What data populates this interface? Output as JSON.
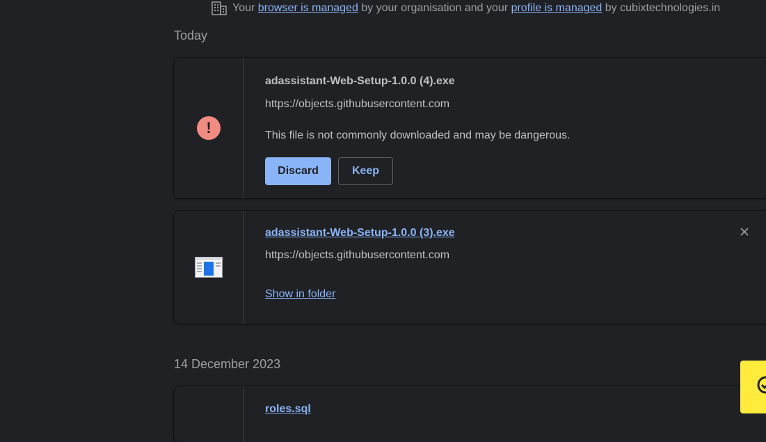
{
  "managed_notice": {
    "prefix": "Your",
    "browser_link": "browser is managed",
    "middle": "by your organisation and your",
    "profile_link": "profile is managed",
    "suffix": "by cubixtechnologies.in"
  },
  "groups": [
    {
      "date": "Today",
      "items": [
        {
          "filename": "adassistant-Web-Setup-1.0.0 (4).exe",
          "url": "https://objects.githubusercontent.com",
          "warning": "This file is not commonly downloaded and may be dangerous.",
          "discard_label": "Discard",
          "keep_label": "Keep",
          "icon": "danger-icon"
        },
        {
          "filename": "adassistant-Web-Setup-1.0.0 (3).exe",
          "url": "https://objects.githubusercontent.com",
          "action_label": "Show in folder",
          "icon": "installer-file-icon"
        }
      ]
    },
    {
      "date": "14 December 2023",
      "items": [
        {
          "filename": "roles.sql",
          "icon": "file-icon"
        }
      ]
    }
  ],
  "colors": {
    "background": "#202124",
    "accent": "#8ab4f8",
    "danger": "#f28b82",
    "widget": "#ffeb3b"
  }
}
